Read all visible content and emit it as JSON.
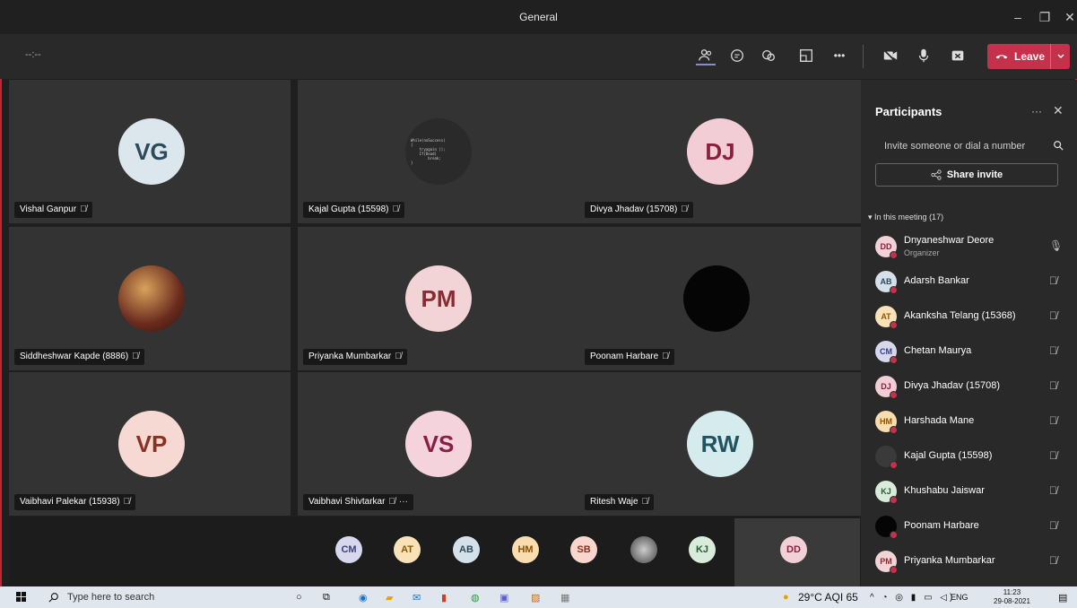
{
  "window": {
    "title": "General",
    "minimize": "–",
    "restore": "❐",
    "close": "✕"
  },
  "toolbar": {
    "timer": "--:--",
    "leave_label": "Leave",
    "more": "•••"
  },
  "grid_tiles": [
    {
      "name": "Vishal Ganpur",
      "initials": "VG",
      "bg": "#dbe7ec",
      "fg": "#2d4a5a"
    },
    {
      "name": "Kajal Gupta (15598)",
      "initials": "",
      "bg": "#2a2a2a",
      "fg": "#ccc",
      "code": "While(noSuccess)\n{\n    tryagain ();\n    If(Dead)\n        break;\n}"
    },
    {
      "name": "Divya Jhadav (15708)",
      "initials": "DJ",
      "bg": "#f2cdd5",
      "fg": "#8a1f3e"
    },
    {
      "name": "Siddheshwar Kapde (8886)",
      "initials": "",
      "bg": "#7a3b2a",
      "fg": "#fff"
    },
    {
      "name": "Priyanka Mumbarkar",
      "initials": "PM",
      "bg": "#f2d4d7",
      "fg": "#8a2a33"
    },
    {
      "name": "Poonam Harbare",
      "initials": "",
      "bg": "#050505",
      "fg": "#fff"
    },
    {
      "name": "Vaibhavi Palekar (15938)",
      "initials": "VP",
      "bg": "#f7d9d3",
      "fg": "#8a3221"
    },
    {
      "name": "Vaibhavi Shivtarkar",
      "initials": "VS",
      "bg": "#f4d3dd",
      "fg": "#8a1f45",
      "extra": "···"
    },
    {
      "name": "Ritesh Waje",
      "initials": "RW",
      "bg": "#d6ebee",
      "fg": "#1f5560"
    }
  ],
  "strip": [
    {
      "initials": "CM",
      "bg": "#d7d8ee",
      "fg": "#3b3f7a"
    },
    {
      "initials": "AT",
      "bg": "#f9e2b8",
      "fg": "#8a5a00"
    },
    {
      "initials": "AB",
      "bg": "#d5e1ea",
      "fg": "#2d4a5a"
    },
    {
      "initials": "HM",
      "bg": "#f9ddb0",
      "fg": "#8a5200"
    },
    {
      "initials": "SB",
      "bg": "#f8d6cd",
      "fg": "#8a3221"
    },
    {
      "initials": "",
      "bg": "#888",
      "fg": "#fff"
    },
    {
      "initials": "KJ",
      "bg": "#d9ecdc",
      "fg": "#2a5a33"
    },
    {
      "initials": "DD",
      "bg": "#f2d0d8",
      "fg": "#8a1f3e"
    }
  ],
  "panel": {
    "title": "Participants",
    "more": "···",
    "close": "✕",
    "invite_placeholder": "Invite someone or dial a number",
    "share_label": "Share invite",
    "section_label": "In this meeting (17)",
    "participants": [
      {
        "initials": "DD",
        "name": "Dnyaneshwar Deore",
        "role": "Organizer",
        "bg": "#f2d0d8",
        "fg": "#8a1f3e",
        "mic": "on"
      },
      {
        "initials": "AB",
        "name": "Adarsh Bankar",
        "role": "",
        "bg": "#d5e1ea",
        "fg": "#2d4a5a",
        "mic": "off"
      },
      {
        "initials": "AT",
        "name": "Akanksha Telang (15368)",
        "role": "",
        "bg": "#f9e2b8",
        "fg": "#8a5a00",
        "mic": "off"
      },
      {
        "initials": "CM",
        "name": "Chetan Maurya",
        "role": "",
        "bg": "#d7d8ee",
        "fg": "#3b3f7a",
        "mic": "off"
      },
      {
        "initials": "DJ",
        "name": "Divya Jhadav (15708)",
        "role": "",
        "bg": "#f2cdd5",
        "fg": "#8a1f3e",
        "mic": "off"
      },
      {
        "initials": "HM",
        "name": "Harshada Mane",
        "role": "",
        "bg": "#f9ddb0",
        "fg": "#8a5200",
        "mic": "off"
      },
      {
        "initials": "",
        "name": "Kajal Gupta (15598)",
        "role": "",
        "bg": "#3a3a3a",
        "fg": "#ccc",
        "mic": "off"
      },
      {
        "initials": "KJ",
        "name": "Khushabu Jaiswar",
        "role": "",
        "bg": "#d9ecdc",
        "fg": "#2a5a33",
        "mic": "off"
      },
      {
        "initials": "",
        "name": "Poonam Harbare",
        "role": "",
        "bg": "#050505",
        "fg": "#fff",
        "mic": "off"
      },
      {
        "initials": "PM",
        "name": "Priyanka Mumbarkar",
        "role": "",
        "bg": "#f2d4d7",
        "fg": "#8a2a33",
        "mic": "off"
      }
    ]
  },
  "taskbar": {
    "search_placeholder": "Type here to search",
    "weather": "29°C AQI 65",
    "lang": "ENG",
    "time": "11:23",
    "date": "29-08-2021"
  }
}
